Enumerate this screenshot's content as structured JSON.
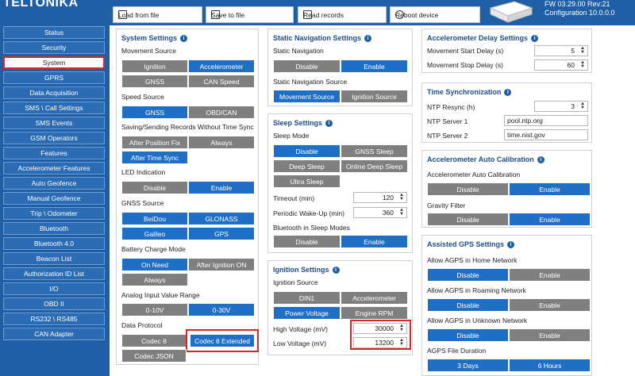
{
  "header": {
    "logo": "TELTONIKA",
    "buttons": {
      "load": "Load from file",
      "save": "Save to file",
      "read": "Read records",
      "reboot": "Reboot device"
    },
    "fw_line1": "FW  03.29.00 Rev:21",
    "fw_line2": "Configuration  10.0.0.0"
  },
  "sidebar": {
    "items": [
      "Status",
      "Security",
      "System",
      "GPRS",
      "Data Acquisition",
      "SMS \\ Call Settings",
      "SMS Events",
      "GSM Operators",
      "Features",
      "Accelerometer Features",
      "Auto Geofence",
      "Manual Geofence",
      "Trip \\ Odometer",
      "Bluetooth",
      "Bluetooth 4.0",
      "Beacon List",
      "Authorization ID List",
      "I/O",
      "OBD II",
      "RS232 \\ RS485",
      "CAN Adapter"
    ],
    "active": "System"
  },
  "system_settings": {
    "title": "System Settings",
    "movement_source": {
      "label": "Movement Source",
      "options": [
        "Ignition",
        "Accelerometer",
        "GNSS",
        "CAN Speed"
      ]
    },
    "speed_source": {
      "label": "Speed Source",
      "options": [
        "GNSS",
        "OBD/CAN"
      ]
    },
    "saving": {
      "label": "Saving/Sending Records Without Time Sync",
      "options": [
        "After Position Fix",
        "Always",
        "After Time Sync"
      ]
    },
    "led": {
      "label": "LED Indication",
      "options": [
        "Disable",
        "Enable"
      ]
    },
    "gnss_source": {
      "label": "GNSS Source",
      "options": [
        "BeiDou",
        "GLONASS",
        "Galileo",
        "GPS"
      ]
    },
    "battery": {
      "label": "Battery Charge Mode",
      "options": [
        "On Need",
        "After Ignition ON",
        "Always"
      ]
    },
    "analog": {
      "label": "Analog Input Value Range",
      "options": [
        "0-10V",
        "0-30V"
      ]
    },
    "protocol": {
      "label": "Data Protocol",
      "options": [
        "Codec 8",
        "Codec 8 Extended",
        "Codec JSON"
      ]
    }
  },
  "static_nav": {
    "title": "Static Navigation Settings",
    "static_nav": {
      "label": "Static Navigation",
      "options": [
        "Disable",
        "Enable"
      ]
    },
    "source": {
      "label": "Static Navigation Source",
      "options": [
        "Movement Source",
        "Ignition Source"
      ]
    }
  },
  "sleep": {
    "title": "Sleep Settings",
    "mode": {
      "label": "Sleep Mode",
      "options": [
        "Disable",
        "GNSS Sleep",
        "Deep Sleep",
        "Online Deep Sleep",
        "Ultra Sleep"
      ]
    },
    "timeout": {
      "label": "Timeout (min)",
      "value": "120"
    },
    "periodic": {
      "label": "Periodic Wake-Up (min)",
      "value": "360"
    },
    "bt": {
      "label": "Bluetooth in Sleep Modes",
      "options": [
        "Disable",
        "Enable"
      ]
    }
  },
  "ignition": {
    "title": "Ignition Settings",
    "source": {
      "label": "Ignition Source",
      "options": [
        "DIN1",
        "Accelerometer",
        "Power Voltage",
        "Engine RPM"
      ]
    },
    "high": {
      "label": "High Voltage (mV)",
      "value": "30000"
    },
    "low": {
      "label": "Low Voltage (mV)",
      "value": "13200"
    }
  },
  "accel_delay": {
    "title": "Accelerometer Delay Settings",
    "start": {
      "label": "Movement Start Delay (s)",
      "value": "5"
    },
    "stop": {
      "label": "Movement Stop Delay (s)",
      "value": "60"
    }
  },
  "time_sync": {
    "title": "Time Synchronization",
    "resync": {
      "label": "NTP Resync (h)",
      "value": "3"
    },
    "server1": {
      "label": "NTP Server 1",
      "value": "pool.ntp.org"
    },
    "server2": {
      "label": "NTP Server 2",
      "value": "time.nist.gov"
    }
  },
  "accel_cal": {
    "title": "Accelerometer Auto Calibration",
    "auto": {
      "label": "Accelerometer Auto Calibration",
      "options": [
        "Disable",
        "Enable"
      ]
    },
    "gravity": {
      "label": "Gravity Filter",
      "options": [
        "Disable",
        "Enable"
      ]
    }
  },
  "agps": {
    "title": "Assisted GPS Settings",
    "home": {
      "label": "Allow AGPS in Home Network",
      "options": [
        "Disable",
        "Enable"
      ]
    },
    "roaming": {
      "label": "Allow AGPS in Roaming Network",
      "options": [
        "Disable",
        "Enable"
      ]
    },
    "unknown": {
      "label": "Allow AGPS in Unknown Network",
      "options": [
        "Disable",
        "Enable"
      ]
    },
    "duration": {
      "label": "AGPS File Duration",
      "options": [
        "3 Days",
        "6 Hours"
      ]
    }
  },
  "colors": {
    "selected": "#1f6fc6",
    "unselected": "#7f7f7f",
    "brand": "#1f5fa6",
    "highlight": "#d9262c"
  },
  "icons": [
    "load-icon",
    "save-icon",
    "read-records-icon",
    "reboot-icon",
    "info-icon",
    "spinner-icon",
    "device-icon"
  ]
}
